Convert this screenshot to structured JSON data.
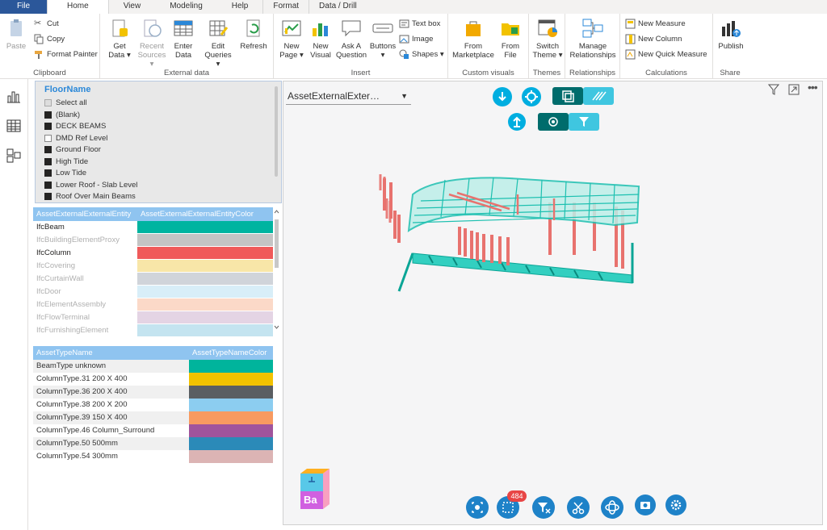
{
  "menu": {
    "tabs": [
      "File",
      "Home",
      "View",
      "Modeling",
      "Help",
      "Format",
      "Data / Drill"
    ]
  },
  "ribbon": {
    "clipboard": {
      "label": "Clipboard",
      "paste": "Paste",
      "cut": "Cut",
      "copy": "Copy",
      "format_painter": "Format Painter"
    },
    "external_data": {
      "label": "External data",
      "get_data": [
        "Get",
        "Data ▾"
      ],
      "recent_sources": [
        "Recent",
        "Sources ▾"
      ],
      "enter_data": [
        "Enter",
        "Data"
      ],
      "edit_queries": [
        "Edit",
        "Queries ▾"
      ],
      "refresh": [
        "Refresh"
      ]
    },
    "insert": {
      "label": "Insert",
      "new_page": [
        "New",
        "Page ▾"
      ],
      "new_visual": [
        "New",
        "Visual"
      ],
      "ask_question": [
        "Ask A",
        "Question"
      ],
      "buttons": [
        "Buttons",
        "▾"
      ],
      "text_box": "Text box",
      "image": "Image",
      "shapes": "Shapes ▾"
    },
    "custom_visuals": {
      "label": "Custom visuals",
      "from_marketplace": [
        "From",
        "Marketplace"
      ],
      "from_file": [
        "From",
        "File"
      ]
    },
    "themes": {
      "label": "Themes",
      "switch_theme": [
        "Switch",
        "Theme ▾"
      ]
    },
    "relationships": {
      "label": "Relationships",
      "manage": [
        "Manage",
        "Relationships"
      ]
    },
    "calculations": {
      "label": "Calculations",
      "new_measure": "New Measure",
      "new_column": "New Column",
      "new_quick_measure": "New Quick Measure"
    },
    "share": {
      "label": "Share",
      "publish": "Publish"
    }
  },
  "slicer": {
    "title": "FloorName",
    "items": [
      {
        "label": "Select all",
        "state": "partial"
      },
      {
        "label": "(Blank)",
        "state": "checked"
      },
      {
        "label": "DECK BEAMS",
        "state": "checked"
      },
      {
        "label": "DMD Ref Level",
        "state": "unchecked"
      },
      {
        "label": "Ground Floor",
        "state": "checked"
      },
      {
        "label": "High Tide",
        "state": "checked"
      },
      {
        "label": "Low Tide",
        "state": "checked"
      },
      {
        "label": "Lower Roof - Slab Level",
        "state": "checked"
      },
      {
        "label": "Roof Over Main Beams",
        "state": "checked"
      }
    ]
  },
  "entity_table": {
    "headers": [
      "AssetExternalExternalEntity",
      "AssetExternalExternalEntityColor"
    ],
    "rows": [
      {
        "name": "IfcBeam",
        "color": "#00b4a0",
        "muted": false
      },
      {
        "name": "IfcBuildingElementProxy",
        "color": "#c4c4c4",
        "muted": true
      },
      {
        "name": "IfcColumn",
        "color": "#f05a5a",
        "muted": false
      },
      {
        "name": "IfcCovering",
        "color": "#f8e6a8",
        "muted": true
      },
      {
        "name": "IfcCurtainWall",
        "color": "#d0d4da",
        "muted": true
      },
      {
        "name": "IfcDoor",
        "color": "#d8eef8",
        "muted": true
      },
      {
        "name": "IfcElementAssembly",
        "color": "#fbd9c8",
        "muted": true
      },
      {
        "name": "IfcFlowTerminal",
        "color": "#e4d4e4",
        "muted": true
      },
      {
        "name": "IfcFurnishingElement",
        "color": "#c4e4f0",
        "muted": true
      }
    ]
  },
  "type_table": {
    "headers": [
      "AssetTypeName",
      "AssetTypeNameColor"
    ],
    "rows": [
      {
        "name": "BeamType unknown",
        "color": "#00b49c"
      },
      {
        "name": "ColumnType.31 200 X 400",
        "color": "#f2c200"
      },
      {
        "name": "ColumnType.36 200 X 400",
        "color": "#5a5e62"
      },
      {
        "name": "ColumnType.38 200 X 200",
        "color": "#8ccdf0"
      },
      {
        "name": "ColumnType.39 150 X 400",
        "color": "#f89a60"
      },
      {
        "name": "ColumnType.46 Column_Surround",
        "color": "#a0549c"
      },
      {
        "name": "ColumnType.50 500mm",
        "color": "#2b8ab8"
      },
      {
        "name": "ColumnType.54 300mm",
        "color": "#dcb4b4"
      }
    ]
  },
  "viewer": {
    "dropdown_value": "AssetExternalExter…",
    "selection_count": "484",
    "cube_label": "Ba"
  }
}
